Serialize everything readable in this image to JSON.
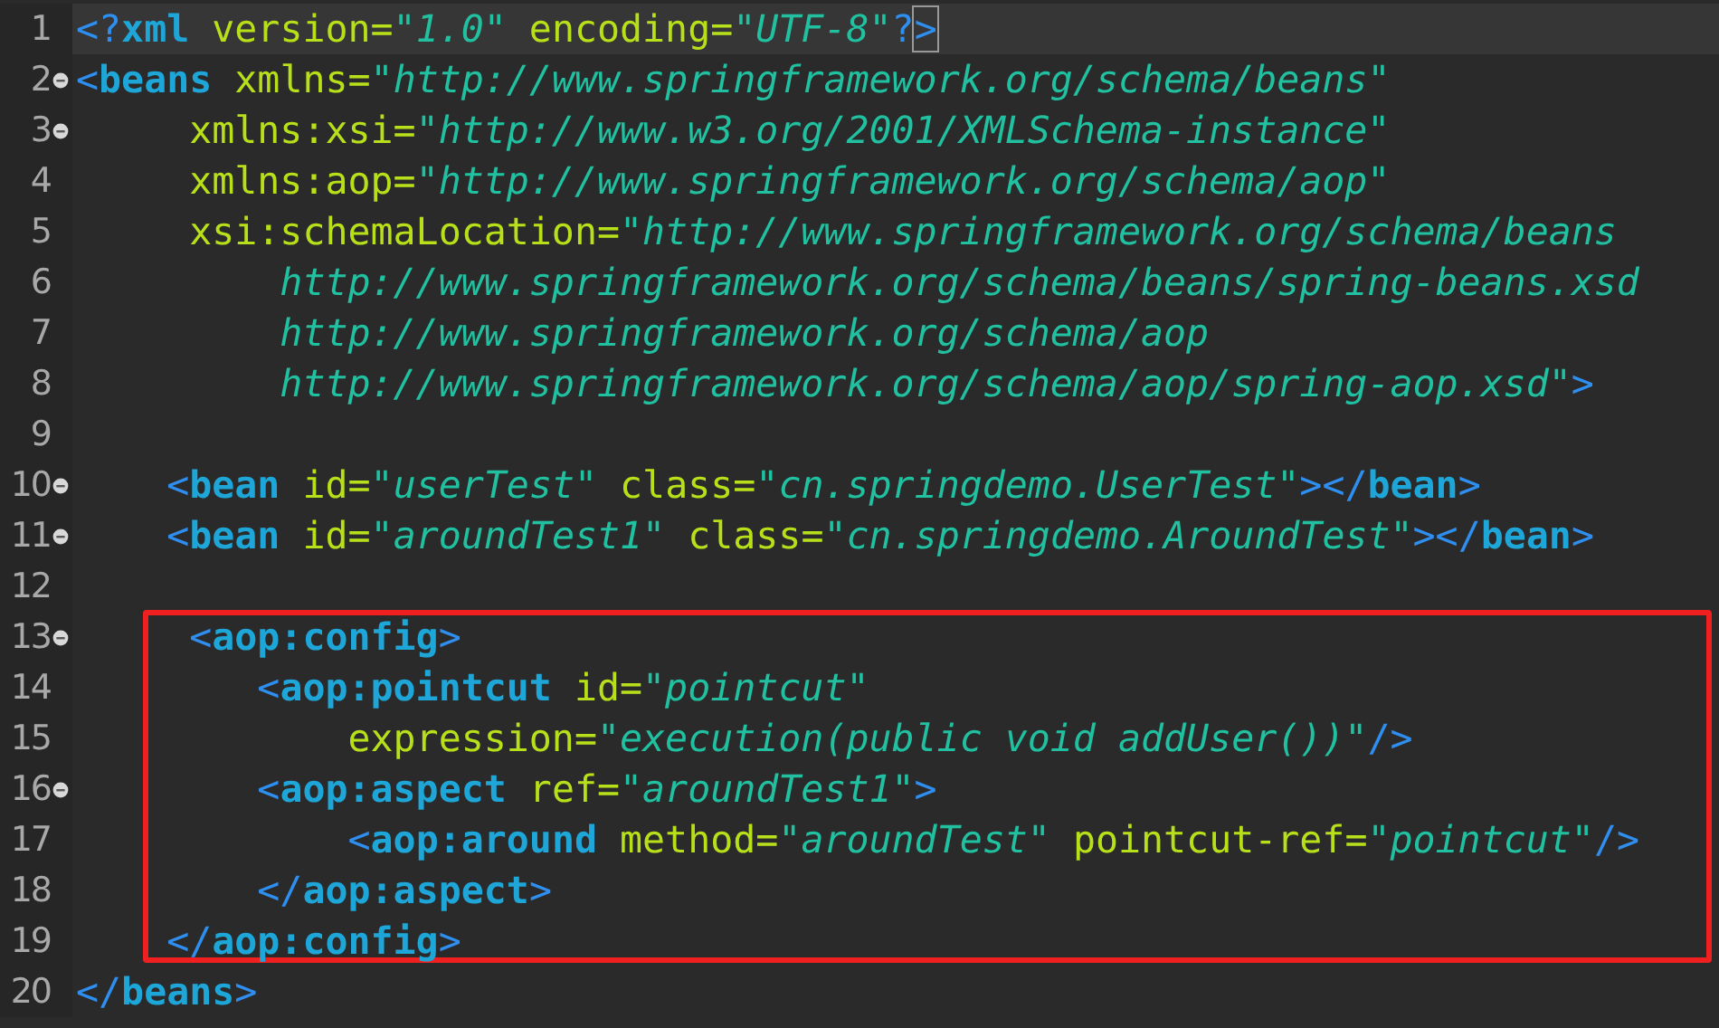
{
  "editor": {
    "sections": [
      {
        "boxed": false,
        "lines": [
          {
            "number": "1",
            "foldable": false,
            "current": true,
            "tokens": [
              {
                "kind": "bracket",
                "text": "<?"
              },
              {
                "kind": "tag",
                "text": "xml"
              },
              {
                "kind": "attr",
                "text": " version="
              },
              {
                "kind": "value",
                "text": "\"1.0\""
              },
              {
                "kind": "attr",
                "text": " encoding="
              },
              {
                "kind": "value",
                "text": "\"UTF-8\""
              },
              {
                "kind": "bracket",
                "text": "?"
              },
              {
                "kind": "match",
                "text": ">"
              }
            ]
          },
          {
            "number": "2",
            "foldable": true,
            "current": false,
            "tokens": [
              {
                "kind": "bracket",
                "text": "<"
              },
              {
                "kind": "tag",
                "text": "beans"
              },
              {
                "kind": "attr",
                "text": " xmlns="
              },
              {
                "kind": "value",
                "text": "\"http://www.springframework.org/schema/beans\""
              }
            ]
          },
          {
            "number": "3",
            "foldable": true,
            "current": false,
            "tokens": [
              {
                "kind": "attr",
                "text": "     xmlns:xsi="
              },
              {
                "kind": "value",
                "text": "\"http://www.w3.org/2001/XMLSchema-instance\""
              }
            ]
          },
          {
            "number": "4",
            "foldable": false,
            "current": false,
            "tokens": [
              {
                "kind": "attr",
                "text": "     xmlns:aop="
              },
              {
                "kind": "value",
                "text": "\"http://www.springframework.org/schema/aop\""
              }
            ]
          },
          {
            "number": "5",
            "foldable": false,
            "current": false,
            "tokens": [
              {
                "kind": "attr",
                "text": "     xsi:schemaLocation="
              },
              {
                "kind": "value",
                "text": "\"http://www.springframework.org/schema/beans"
              }
            ]
          },
          {
            "number": "6",
            "foldable": false,
            "current": false,
            "tokens": [
              {
                "kind": "value",
                "text": "         http://www.springframework.org/schema/beans/spring-beans.xsd"
              }
            ]
          },
          {
            "number": "7",
            "foldable": false,
            "current": false,
            "tokens": [
              {
                "kind": "value",
                "text": "         http://www.springframework.org/schema/aop"
              }
            ]
          },
          {
            "number": "8",
            "foldable": false,
            "current": false,
            "tokens": [
              {
                "kind": "value",
                "text": "         http://www.springframework.org/schema/aop/spring-aop.xsd\""
              },
              {
                "kind": "bracket",
                "text": ">"
              }
            ]
          },
          {
            "number": "9",
            "foldable": false,
            "current": false
          },
          {
            "number": "10",
            "foldable": true,
            "current": false,
            "tokens": [
              {
                "kind": "bracket",
                "text": "    <"
              },
              {
                "kind": "tag",
                "text": "bean"
              },
              {
                "kind": "attr",
                "text": " id="
              },
              {
                "kind": "value",
                "text": "\"userTest\""
              },
              {
                "kind": "attr",
                "text": " class="
              },
              {
                "kind": "value",
                "text": "\"cn.springdemo.UserTest\""
              },
              {
                "kind": "bracket",
                "text": "></"
              },
              {
                "kind": "tag",
                "text": "bean"
              },
              {
                "kind": "bracket",
                "text": ">"
              }
            ]
          },
          {
            "number": "11",
            "foldable": true,
            "current": false,
            "tokens": [
              {
                "kind": "bracket",
                "text": "    <"
              },
              {
                "kind": "tag",
                "text": "bean"
              },
              {
                "kind": "attr",
                "text": " id="
              },
              {
                "kind": "value",
                "text": "\"aroundTest1\""
              },
              {
                "kind": "attr",
                "text": " class="
              },
              {
                "kind": "value",
                "text": "\"cn.springdemo.AroundTest\""
              },
              {
                "kind": "bracket",
                "text": "></"
              },
              {
                "kind": "tag",
                "text": "bean"
              },
              {
                "kind": "bracket",
                "text": ">"
              }
            ]
          },
          {
            "number": "12",
            "foldable": false,
            "current": false
          }
        ]
      },
      {
        "boxed": true,
        "lines": [
          {
            "number": "13",
            "foldable": true,
            "current": false,
            "tokens": [
              {
                "kind": "bracket",
                "text": "     <"
              },
              {
                "kind": "tag",
                "text": "aop:config"
              },
              {
                "kind": "bracket",
                "text": ">"
              }
            ]
          },
          {
            "number": "14",
            "foldable": false,
            "current": false,
            "tokens": [
              {
                "kind": "bracket",
                "text": "        <"
              },
              {
                "kind": "tag",
                "text": "aop:pointcut"
              },
              {
                "kind": "attr",
                "text": " id="
              },
              {
                "kind": "value",
                "text": "\"pointcut\""
              }
            ]
          },
          {
            "number": "15",
            "foldable": false,
            "current": false,
            "tokens": [
              {
                "kind": "attr",
                "text": "            expression="
              },
              {
                "kind": "value",
                "text": "\"execution(public void addUser())\""
              },
              {
                "kind": "bracket",
                "text": "/>"
              }
            ]
          },
          {
            "number": "16",
            "foldable": true,
            "current": false,
            "tokens": [
              {
                "kind": "bracket",
                "text": "        <"
              },
              {
                "kind": "tag",
                "text": "aop:aspect"
              },
              {
                "kind": "attr",
                "text": " ref="
              },
              {
                "kind": "value",
                "text": "\"aroundTest1\""
              },
              {
                "kind": "bracket",
                "text": ">"
              }
            ]
          },
          {
            "number": "17",
            "foldable": false,
            "current": false,
            "tokens": [
              {
                "kind": "bracket",
                "text": "            <"
              },
              {
                "kind": "tag",
                "text": "aop:around"
              },
              {
                "kind": "attr",
                "text": " method="
              },
              {
                "kind": "value",
                "text": "\"aroundTest\""
              },
              {
                "kind": "attr",
                "text": " pointcut-ref="
              },
              {
                "kind": "value",
                "text": "\"pointcut\""
              },
              {
                "kind": "bracket",
                "text": "/>"
              }
            ]
          },
          {
            "number": "18",
            "foldable": false,
            "current": false,
            "tokens": [
              {
                "kind": "bracket",
                "text": "        </"
              },
              {
                "kind": "tag",
                "text": "aop:aspect"
              },
              {
                "kind": "bracket",
                "text": ">"
              }
            ]
          },
          {
            "number": "19",
            "foldable": false,
            "current": false,
            "tokens": [
              {
                "kind": "bracket",
                "text": "    </"
              },
              {
                "kind": "tag",
                "text": "aop:config"
              },
              {
                "kind": "bracket",
                "text": ">"
              }
            ]
          }
        ]
      },
      {
        "boxed": false,
        "lines": [
          {
            "number": "20",
            "foldable": false,
            "current": false,
            "tokens": [
              {
                "kind": "bracket",
                "text": "</"
              },
              {
                "kind": "tag",
                "text": "beans"
              },
              {
                "kind": "bracket",
                "text": ">"
              }
            ]
          }
        ]
      }
    ]
  }
}
